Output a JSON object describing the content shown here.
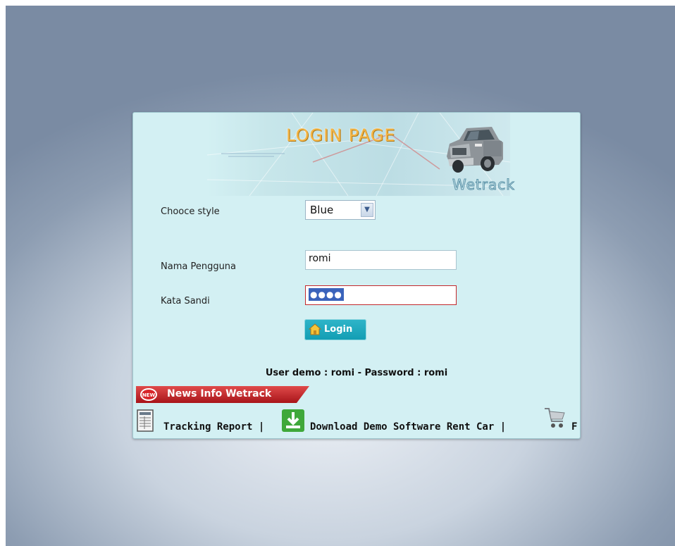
{
  "banner": {
    "title": "LOGIN PAGE",
    "brand": "Wetrack"
  },
  "form": {
    "style_label": "Chooce style",
    "style_value": "Blue",
    "username_label": "Nama Pengguna",
    "username_value": "romi",
    "password_label": "Kata Sandi",
    "password_mask": "●●●●",
    "login_label": "Login"
  },
  "demo_note": "User demo : romi - Password : romi",
  "news": {
    "badge": "NEW",
    "title": "News Info Wetrack"
  },
  "ticker": {
    "items": [
      "Tracking Report |",
      "Download Demo Software Rent Car |",
      "F"
    ]
  },
  "colors": {
    "panel_bg": "#d3f0f3",
    "login_button": "#129db3",
    "news_red": "#c41d1d",
    "banner_title": "#f4b546"
  }
}
